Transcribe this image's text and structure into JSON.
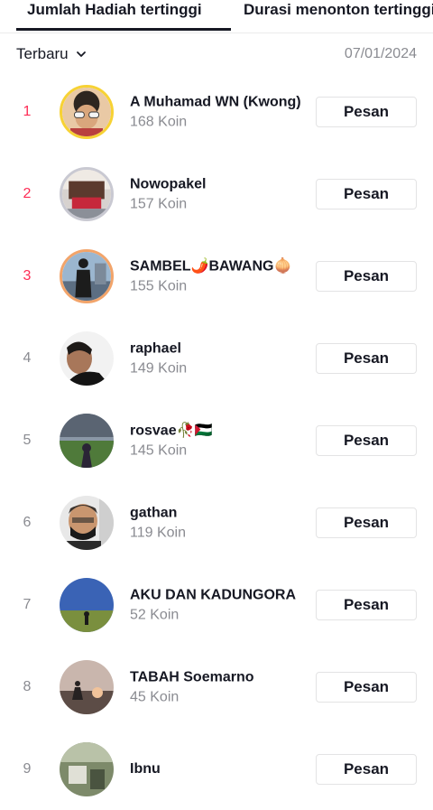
{
  "tabs": [
    {
      "label": "Jumlah Hadiah tertinggi",
      "active": true
    },
    {
      "label": "Durasi menonton tertinggi",
      "active": false
    }
  ],
  "filter": {
    "selected": "Terbaru",
    "icon": "chevron-down-icon"
  },
  "date": "07/01/2024",
  "ranking": [
    {
      "rank": "1",
      "name": "A Muhamad WN (Kwong)",
      "coins": "168 Koin",
      "button": "Pesan"
    },
    {
      "rank": "2",
      "name": "Nowopakel",
      "coins": "157 Koin",
      "button": "Pesan"
    },
    {
      "rank": "3",
      "name": "SAMBEL🌶️BAWANG🧅",
      "coins": "155 Koin",
      "button": "Pesan"
    },
    {
      "rank": "4",
      "name": "raphael",
      "coins": "149 Koin",
      "button": "Pesan"
    },
    {
      "rank": "5",
      "name": "rosvae🥀🇵🇸",
      "coins": "145 Koin",
      "button": "Pesan"
    },
    {
      "rank": "6",
      "name": "gathan",
      "coins": "119 Koin",
      "button": "Pesan"
    },
    {
      "rank": "7",
      "name": "AKU DAN KADUNGORA",
      "coins": "52 Koin",
      "button": "Pesan"
    },
    {
      "rank": "8",
      "name": "TABAH Soemarno",
      "coins": "45 Koin",
      "button": "Pesan"
    },
    {
      "rank": "9",
      "name": "Ibnu",
      "coins": "",
      "button": "Pesan"
    }
  ],
  "colors": {
    "accent_rank": "#fe2c55",
    "gold_ring": "#f7d234",
    "silver_ring": "#c9c9d2",
    "bronze_ring": "#f2a46a",
    "muted_text": "#8a8b91"
  }
}
